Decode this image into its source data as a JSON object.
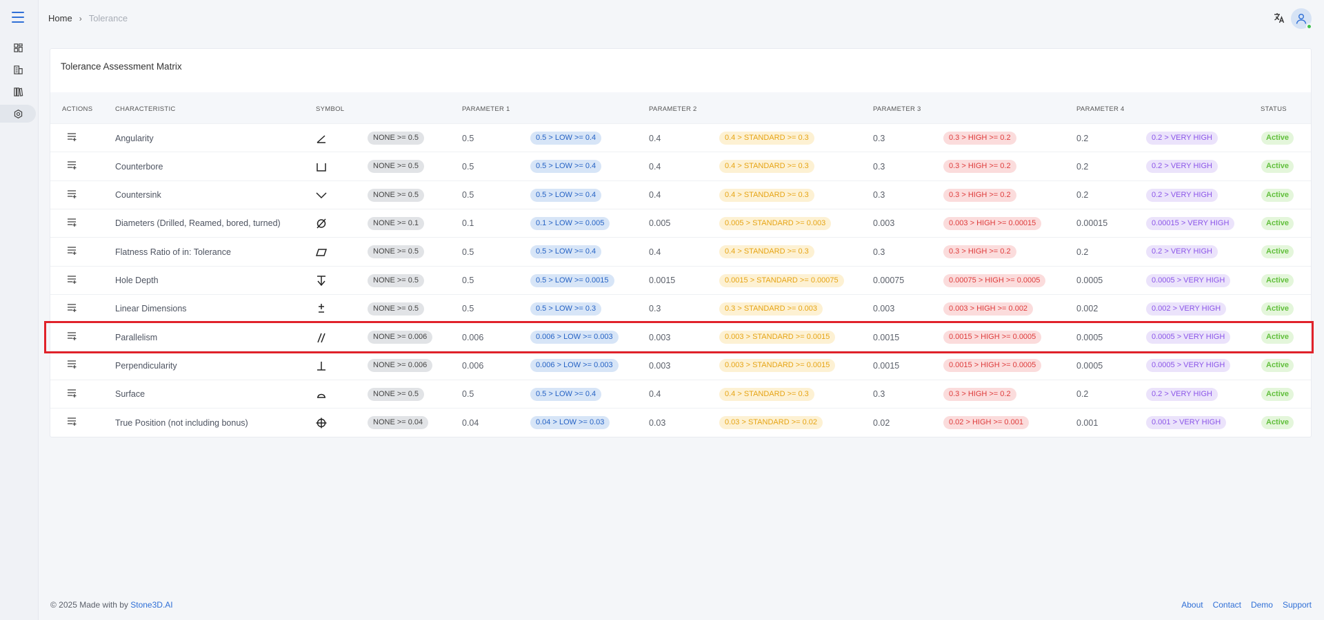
{
  "breadcrumb": {
    "home": "Home",
    "separator": "›",
    "current": "Tolerance"
  },
  "icons": {
    "menu": "hamburger-menu-icon",
    "nav": [
      "dashboard-icon",
      "building-icon",
      "library-icon",
      "settings-icon"
    ],
    "translate": "translate-icon",
    "avatar": "user-avatar-icon"
  },
  "card": {
    "title": "Tolerance Assessment Matrix"
  },
  "columns": {
    "actions": "ACTIONS",
    "characteristic": "CHARACTERISTIC",
    "symbol": "SYMBOL",
    "param1": "PARAMETER 1",
    "param2": "PARAMETER 2",
    "param3": "PARAMETER 3",
    "param4": "PARAMETER 4",
    "status": "STATUS"
  },
  "rows": [
    {
      "name": "Angularity",
      "symbol": "angularity",
      "none": "NONE >= 0.5",
      "p1": "0.5",
      "low": "0.5 > LOW >= 0.4",
      "p2": "0.4",
      "std": "0.4 > STANDARD >= 0.3",
      "p3": "0.3",
      "high": "0.3 > HIGH >= 0.2",
      "p4": "0.2",
      "vh": "0.2 > VERY HIGH",
      "status": "Active"
    },
    {
      "name": "Counterbore",
      "symbol": "counterbore",
      "none": "NONE >= 0.5",
      "p1": "0.5",
      "low": "0.5 > LOW >= 0.4",
      "p2": "0.4",
      "std": "0.4 > STANDARD >= 0.3",
      "p3": "0.3",
      "high": "0.3 > HIGH >= 0.2",
      "p4": "0.2",
      "vh": "0.2 > VERY HIGH",
      "status": "Active"
    },
    {
      "name": "Countersink",
      "symbol": "countersink",
      "none": "NONE >= 0.5",
      "p1": "0.5",
      "low": "0.5 > LOW >= 0.4",
      "p2": "0.4",
      "std": "0.4 > STANDARD >= 0.3",
      "p3": "0.3",
      "high": "0.3 > HIGH >= 0.2",
      "p4": "0.2",
      "vh": "0.2 > VERY HIGH",
      "status": "Active"
    },
    {
      "name": "Diameters (Drilled, Reamed, bored, turned)",
      "symbol": "diameter",
      "none": "NONE >= 0.1",
      "p1": "0.1",
      "low": "0.1 > LOW >= 0.005",
      "p2": "0.005",
      "std": "0.005 > STANDARD >= 0.003",
      "p3": "0.003",
      "high": "0.003 > HIGH >= 0.00015",
      "p4": "0.00015",
      "vh": "0.00015 > VERY HIGH",
      "status": "Active"
    },
    {
      "name": "Flatness Ratio of in: Tolerance",
      "symbol": "flatness",
      "none": "NONE >= 0.5",
      "p1": "0.5",
      "low": "0.5 > LOW >= 0.4",
      "p2": "0.4",
      "std": "0.4 > STANDARD >= 0.3",
      "p3": "0.3",
      "high": "0.3 > HIGH >= 0.2",
      "p4": "0.2",
      "vh": "0.2 > VERY HIGH",
      "status": "Active"
    },
    {
      "name": "Hole Depth",
      "symbol": "depth",
      "none": "NONE >= 0.5",
      "p1": "0.5",
      "low": "0.5 > LOW >= 0.0015",
      "p2": "0.0015",
      "std": "0.0015 > STANDARD >= 0.00075",
      "p3": "0.00075",
      "high": "0.00075 > HIGH >= 0.0005",
      "p4": "0.0005",
      "vh": "0.0005 > VERY HIGH",
      "status": "Active"
    },
    {
      "name": "Linear Dimensions",
      "symbol": "plusminus",
      "none": "NONE >= 0.5",
      "p1": "0.5",
      "low": "0.5 > LOW >= 0.3",
      "p2": "0.3",
      "std": "0.3 > STANDARD >= 0.003",
      "p3": "0.003",
      "high": "0.003 > HIGH >= 0.002",
      "p4": "0.002",
      "vh": "0.002 > VERY HIGH",
      "status": "Active"
    },
    {
      "name": "Parallelism",
      "symbol": "parallelism",
      "none": "NONE >= 0.006",
      "p1": "0.006",
      "low": "0.006 > LOW >= 0.003",
      "p2": "0.003",
      "std": "0.003 > STANDARD >= 0.0015",
      "p3": "0.0015",
      "high": "0.0015 > HIGH >= 0.0005",
      "p4": "0.0005",
      "vh": "0.0005 > VERY HIGH",
      "status": "Active"
    },
    {
      "name": "Perpendicularity",
      "symbol": "perpendicularity",
      "none": "NONE >= 0.006",
      "p1": "0.006",
      "low": "0.006 > LOW >= 0.003",
      "p2": "0.003",
      "std": "0.003 > STANDARD >= 0.0015",
      "p3": "0.0015",
      "high": "0.0015 > HIGH >= 0.0005",
      "p4": "0.0005",
      "vh": "0.0005 > VERY HIGH",
      "status": "Active"
    },
    {
      "name": "Surface",
      "symbol": "surface",
      "none": "NONE >= 0.5",
      "p1": "0.5",
      "low": "0.5 > LOW >= 0.4",
      "p2": "0.4",
      "std": "0.4 > STANDARD >= 0.3",
      "p3": "0.3",
      "high": "0.3 > HIGH >= 0.2",
      "p4": "0.2",
      "vh": "0.2 > VERY HIGH",
      "status": "Active"
    },
    {
      "name": "True Position (not including bonus)",
      "symbol": "position",
      "none": "NONE >= 0.04",
      "p1": "0.04",
      "low": "0.04 > LOW >= 0.03",
      "p2": "0.03",
      "std": "0.03 > STANDARD >= 0.02",
      "p3": "0.02",
      "high": "0.02 > HIGH >= 0.001",
      "p4": "0.001",
      "vh": "0.001 > VERY HIGH",
      "status": "Active"
    }
  ],
  "highlighted_row": "Parallelism",
  "footer": {
    "copyright": "© 2025 Made with by",
    "brand": "Stone3D.AI",
    "links": [
      "About",
      "Contact",
      "Demo",
      "Support"
    ]
  },
  "colors": {
    "accent": "#2f6fd6",
    "highlight_border": "#e0222a",
    "status_active": "#61bf3c"
  }
}
